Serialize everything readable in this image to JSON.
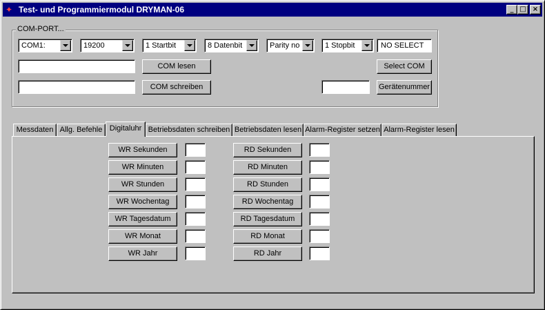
{
  "window": {
    "title": "Test- und Programmiermodul DRYMAN-06",
    "app_icon": "dryman-app-icon",
    "minimize_glyph": "_",
    "maximize_glyph": "□",
    "close_glyph": "×"
  },
  "comport": {
    "group_label": "COM-PORT...",
    "port": "COM1:",
    "baud": "19200",
    "startbit": "1 Startbit",
    "datenbit": "8 Datenbit",
    "parity": "Parity no",
    "stopbit": "1 Stopbit",
    "status": "NO SELECT",
    "read_value": "",
    "write_value": "",
    "device_number_value": "",
    "read_button": "COM lesen",
    "write_button": "COM schreiben",
    "select_button": "Select COM",
    "device_button": "Gerätenummer"
  },
  "tabs": [
    {
      "label": "Messdaten"
    },
    {
      "label": "Allg. Befehle"
    },
    {
      "label": "Digitaluhr"
    },
    {
      "label": "Betriebsdaten schreiben"
    },
    {
      "label": "Betriebsdaten lesen"
    },
    {
      "label": "Alarm-Register setzen"
    },
    {
      "label": "Alarm-Register lesen"
    }
  ],
  "active_tab": "Digitaluhr",
  "digitaluhr": {
    "write": [
      {
        "label": "WR Sekunden",
        "value": ""
      },
      {
        "label": "WR Minuten",
        "value": ""
      },
      {
        "label": "WR Stunden",
        "value": ""
      },
      {
        "label": "WR Wochentag",
        "value": ""
      },
      {
        "label": "WR Tagesdatum",
        "value": ""
      },
      {
        "label": "WR Monat",
        "value": ""
      },
      {
        "label": "WR Jahr",
        "value": ""
      }
    ],
    "read": [
      {
        "label": "RD Sekunden",
        "value": ""
      },
      {
        "label": "RD Minuten",
        "value": ""
      },
      {
        "label": "RD Stunden",
        "value": ""
      },
      {
        "label": "RD Wochentag",
        "value": ""
      },
      {
        "label": "RD Tagesdatum",
        "value": ""
      },
      {
        "label": "RD Monat",
        "value": ""
      },
      {
        "label": "RD Jahr",
        "value": ""
      }
    ]
  }
}
